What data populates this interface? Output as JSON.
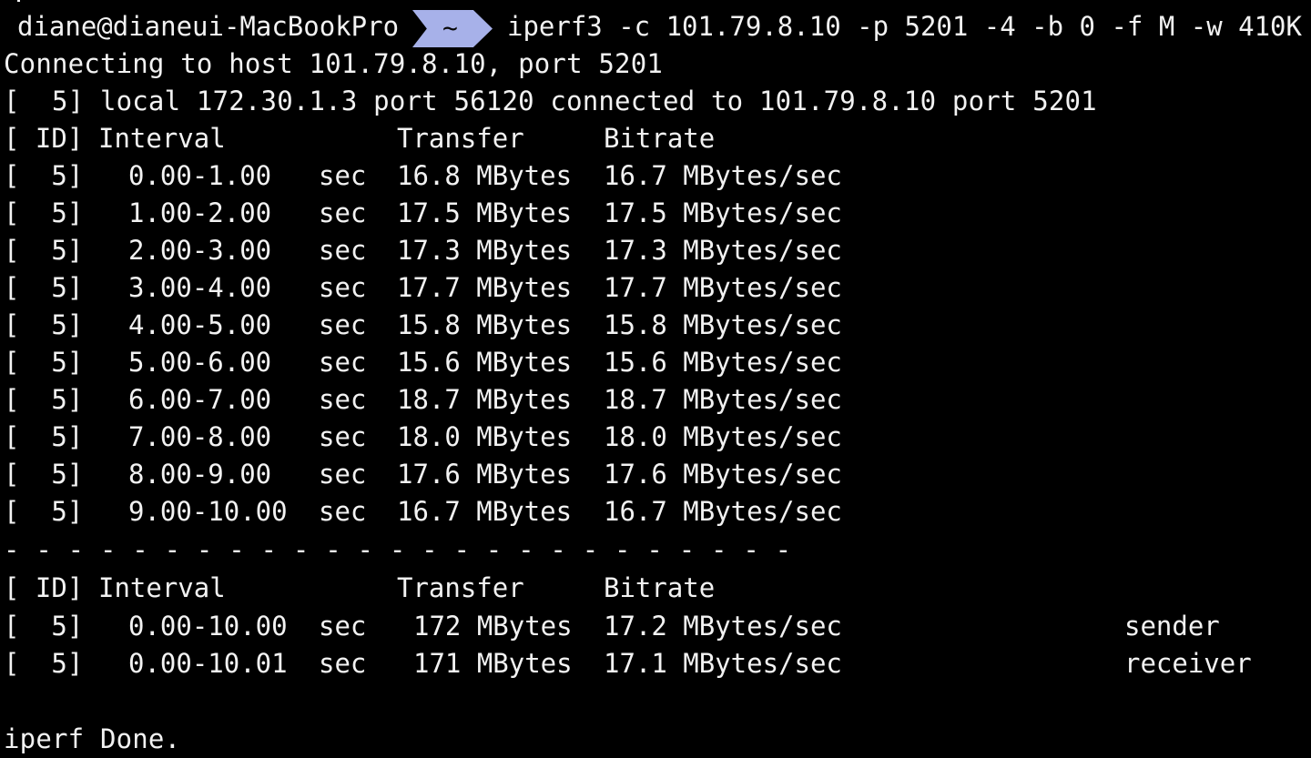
{
  "prompt": {
    "user_host": "diane@dianeui-MacBookPro",
    "directory": "~",
    "command": "iperf3 -c 101.79.8.10 -p 5201 -4 -b 0 -f M -w 410K"
  },
  "connection": {
    "connecting_line": "Connecting to host 101.79.8.10, port 5201",
    "local_line": "[  5] local 172.30.1.3 port 56120 connected to 101.79.8.10 port 5201"
  },
  "interval_header": {
    "id": "[ ID]",
    "interval": "Interval",
    "transfer": "Transfer",
    "bitrate": "Bitrate"
  },
  "intervals": [
    {
      "id": "[  5]",
      "interval": "0.00-1.00",
      "unit": "sec",
      "transfer": "16.8 MBytes",
      "bitrate": "16.7 MBytes/sec"
    },
    {
      "id": "[  5]",
      "interval": "1.00-2.00",
      "unit": "sec",
      "transfer": "17.5 MBytes",
      "bitrate": "17.5 MBytes/sec"
    },
    {
      "id": "[  5]",
      "interval": "2.00-3.00",
      "unit": "sec",
      "transfer": "17.3 MBytes",
      "bitrate": "17.3 MBytes/sec"
    },
    {
      "id": "[  5]",
      "interval": "3.00-4.00",
      "unit": "sec",
      "transfer": "17.7 MBytes",
      "bitrate": "17.7 MBytes/sec"
    },
    {
      "id": "[  5]",
      "interval": "4.00-5.00",
      "unit": "sec",
      "transfer": "15.8 MBytes",
      "bitrate": "15.8 MBytes/sec"
    },
    {
      "id": "[  5]",
      "interval": "5.00-6.00",
      "unit": "sec",
      "transfer": "15.6 MBytes",
      "bitrate": "15.6 MBytes/sec"
    },
    {
      "id": "[  5]",
      "interval": "6.00-7.00",
      "unit": "sec",
      "transfer": "18.7 MBytes",
      "bitrate": "18.7 MBytes/sec"
    },
    {
      "id": "[  5]",
      "interval": "7.00-8.00",
      "unit": "sec",
      "transfer": "18.0 MBytes",
      "bitrate": "18.0 MBytes/sec"
    },
    {
      "id": "[  5]",
      "interval": "8.00-9.00",
      "unit": "sec",
      "transfer": "17.6 MBytes",
      "bitrate": "17.6 MBytes/sec"
    },
    {
      "id": "[  5]",
      "interval": "9.00-10.00",
      "unit": "sec",
      "transfer": "16.7 MBytes",
      "bitrate": "16.7 MBytes/sec"
    }
  ],
  "separator": "- - - - - - - - - - - - - - - - - - - - - - - - -",
  "summary_header": {
    "id": "[ ID]",
    "interval": "Interval",
    "transfer": "Transfer",
    "bitrate": "Bitrate"
  },
  "summary": [
    {
      "id": "[  5]",
      "interval": "0.00-10.00",
      "unit": "sec",
      "transfer": "172 MBytes",
      "bitrate": "17.2 MBytes/sec",
      "role": "sender"
    },
    {
      "id": "[  5]",
      "interval": "0.00-10.01",
      "unit": "sec",
      "transfer": "171 MBytes",
      "bitrate": "17.1 MBytes/sec",
      "role": "receiver"
    }
  ],
  "done": "iperf Done.",
  "colors": {
    "background": "#000000",
    "text": "#f2f2f2",
    "prompt_segment": "#a7b1e9",
    "prompt_segment_text": "#050505"
  }
}
